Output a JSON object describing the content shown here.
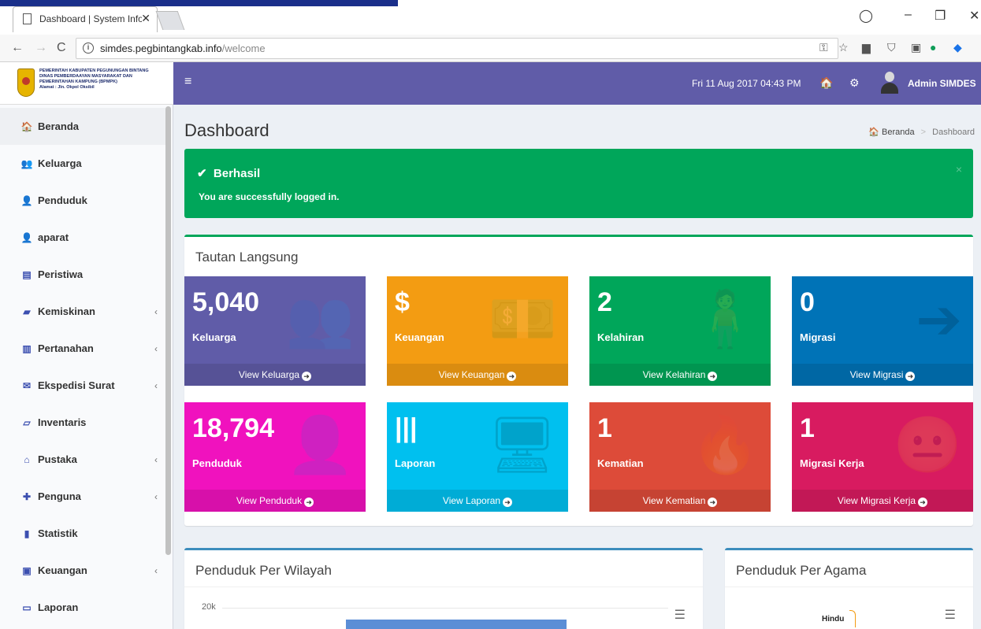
{
  "browser": {
    "tab_title": "Dashboard | System Infor",
    "url_host": "simdes.pegbintangkab.info",
    "url_path": "/welcome"
  },
  "logo": {
    "lines": [
      "PEMERINTAH KABUPATEN PEGUNUNGAN BINTANG",
      "DINAS PEMBERDAAYAN MASYARAKAT DAN",
      "PEMERINTAHAN KAMPUNG (BPMPK)",
      "Alamat : Jln. Okpol Oksibil"
    ]
  },
  "navbar": {
    "datetime": "Fri 11 Aug 2017 04:43 PM",
    "user": "Admin SIMDES"
  },
  "sidebar": {
    "items": [
      {
        "label": "Beranda",
        "icon": "home-icon",
        "glyph": "🏠",
        "has_chevron": false
      },
      {
        "label": "Keluarga",
        "icon": "users-icon",
        "glyph": "👥",
        "has_chevron": false
      },
      {
        "label": "Penduduk",
        "icon": "user-icon",
        "glyph": "👤",
        "has_chevron": false
      },
      {
        "label": "aparat",
        "icon": "user-icon",
        "glyph": "👤",
        "has_chevron": false
      },
      {
        "label": "Peristiwa",
        "icon": "newspaper-icon",
        "glyph": "▤",
        "has_chevron": false
      },
      {
        "label": "Kemiskinan",
        "icon": "book-icon",
        "glyph": "▰",
        "has_chevron": true
      },
      {
        "label": "Pertanahan",
        "icon": "map-icon",
        "glyph": "▥",
        "has_chevron": true
      },
      {
        "label": "Ekspedisi Surat",
        "icon": "envelope-icon",
        "glyph": "✉",
        "has_chevron": true
      },
      {
        "label": "Inventaris",
        "icon": "folder-open-icon",
        "glyph": "▱",
        "has_chevron": false
      },
      {
        "label": "Pustaka",
        "icon": "bank-icon",
        "glyph": "⌂",
        "has_chevron": true
      },
      {
        "label": "Penguna",
        "icon": "user-plus-icon",
        "glyph": "✚",
        "has_chevron": true
      },
      {
        "label": "Statistik",
        "icon": "bar-chart-icon",
        "glyph": "▮",
        "has_chevron": false
      },
      {
        "label": "Keuangan",
        "icon": "money-icon",
        "glyph": "▣",
        "has_chevron": true
      },
      {
        "label": "Laporan",
        "icon": "desktop-icon",
        "glyph": "▭",
        "has_chevron": false
      }
    ]
  },
  "content": {
    "title": "Dashboard",
    "breadcrumb": {
      "home": "Beranda",
      "current": "Dashboard"
    }
  },
  "alert": {
    "heading": "Berhasil",
    "message": "You are successfully logged in.",
    "close": "×"
  },
  "tautan": {
    "title": "Tautan Langsung",
    "tiles": [
      {
        "value": "5,040",
        "label": "Keluarga",
        "link": "View Keluarga",
        "color": "#605ca8",
        "icon": "users-icon",
        "glyph": "👥"
      },
      {
        "value": "$",
        "label": "Keuangan",
        "link": "View Keuangan",
        "color": "#f39c12",
        "icon": "money-icon",
        "glyph": "💵"
      },
      {
        "value": "2",
        "label": "Kelahiran",
        "link": "View Kelahiran",
        "color": "#00a65a",
        "icon": "child-icon",
        "glyph": "🧍"
      },
      {
        "value": "0",
        "label": "Migrasi",
        "link": "View Migrasi",
        "color": "#0073b7",
        "icon": "sign-out-icon",
        "glyph": "➔"
      },
      {
        "value": "18,794",
        "label": "Penduduk",
        "link": "View Penduduk",
        "color": "#f012be",
        "icon": "user-icon",
        "glyph": "👤"
      },
      {
        "value": "|||",
        "label": "Laporan",
        "link": "View Laporan",
        "color": "#00c0ef",
        "icon": "desktop-icon",
        "glyph": "🖥"
      },
      {
        "value": "1",
        "label": "Kematian",
        "link": "View Kematian",
        "color": "#dd4b39",
        "icon": "fire-icon",
        "glyph": "🔥"
      },
      {
        "value": "1",
        "label": "Migrasi Kerja",
        "link": "View Migrasi Kerja",
        "color": "#d81b60",
        "icon": "meh-icon",
        "glyph": "😐"
      }
    ]
  },
  "panels": {
    "wilayah": {
      "title": "Penduduk Per Wilayah",
      "tick": "20k"
    },
    "agama": {
      "title": "Penduduk Per Agama",
      "label": "Hindu"
    }
  }
}
